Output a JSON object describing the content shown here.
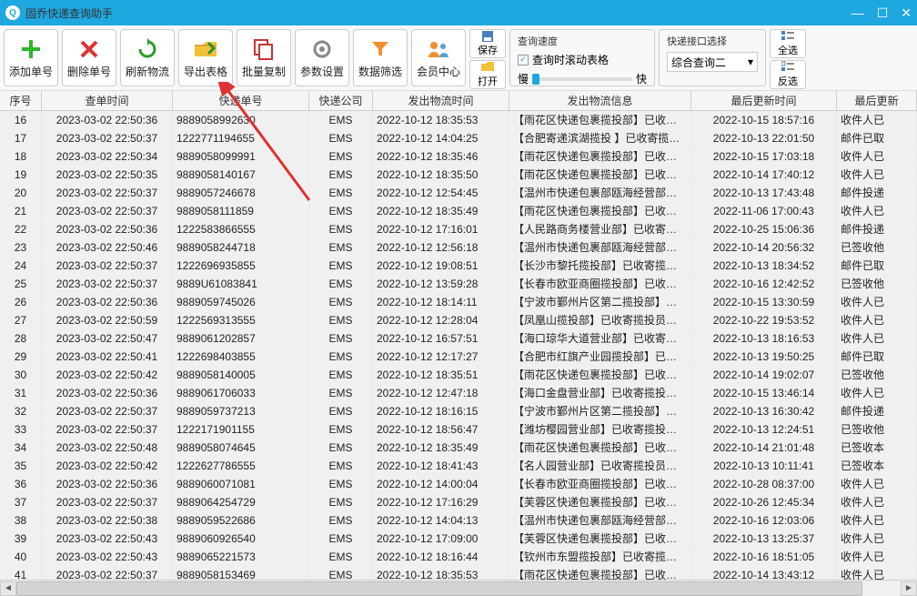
{
  "window": {
    "title": "固乔快递查询助手"
  },
  "toolbar": {
    "add": "添加单号",
    "del": "删除单号",
    "refresh": "刷新物流",
    "export": "导出表格",
    "copy": "批量复制",
    "params": "参数设置",
    "filter": "数据筛选",
    "member": "会员中心",
    "save": "保存",
    "open": "打开",
    "select_all": "全选",
    "invert": "反选"
  },
  "speed": {
    "group_label": "查询速度",
    "scroll_label": "查询时滚动表格",
    "slow": "慢",
    "fast": "快"
  },
  "interface": {
    "group_label": "快递接口选择",
    "selected": "综合查询二"
  },
  "columns": [
    "序号",
    "查单时间",
    "快递单号",
    "快递公司",
    "发出物流时间",
    "发出物流信息",
    "最后更新时间",
    "最后更新"
  ],
  "rows": [
    {
      "n": "16",
      "t": "2023-03-02 22:50:36",
      "no": "9889058992630",
      "co": "EMS",
      "ot": "2022-10-12 18:35:53",
      "oi": "【雨花区快递包裹揽投部】已收…",
      "lt": "2022-10-15 18:57:16",
      "ls": "收件人已"
    },
    {
      "n": "17",
      "t": "2023-03-02 22:50:37",
      "no": "1222771194655",
      "co": "EMS",
      "ot": "2022-10-12 14:04:25",
      "oi": "【合肥寄递滨湖揽投 】已收寄揽…",
      "lt": "2022-10-13 22:01:50",
      "ls": "邮件已取"
    },
    {
      "n": "18",
      "t": "2023-03-02 22:50:34",
      "no": "9889058099991",
      "co": "EMS",
      "ot": "2022-10-12 18:35:46",
      "oi": "【雨花区快递包裹揽投部】已收…",
      "lt": "2022-10-15 17:03:18",
      "ls": "收件人已"
    },
    {
      "n": "19",
      "t": "2023-03-02 22:50:35",
      "no": "9889058140167",
      "co": "EMS",
      "ot": "2022-10-12 18:35:50",
      "oi": "【雨花区快递包裹揽投部】已收…",
      "lt": "2022-10-14 17:40:12",
      "ls": "收件人已"
    },
    {
      "n": "20",
      "t": "2023-03-02 22:50:37",
      "no": "9889057246678",
      "co": "EMS",
      "ot": "2022-10-12 12:54:45",
      "oi": "【温州市快递包裹部瓯海经营部…",
      "lt": "2022-10-13 17:43:48",
      "ls": "邮件投递"
    },
    {
      "n": "21",
      "t": "2023-03-02 22:50:37",
      "no": "9889058111859",
      "co": "EMS",
      "ot": "2022-10-12 18:35:49",
      "oi": "【雨花区快递包裹揽投部】已收…",
      "lt": "2022-11-06 17:00:43",
      "ls": "收件人已"
    },
    {
      "n": "22",
      "t": "2023-03-02 22:50:36",
      "no": "1222583866555",
      "co": "EMS",
      "ot": "2022-10-12 17:16:01",
      "oi": "【人民路商务楼营业部】已收寄…",
      "lt": "2022-10-25 15:06:36",
      "ls": "邮件投递"
    },
    {
      "n": "23",
      "t": "2023-03-02 22:50:46",
      "no": "9889058244718",
      "co": "EMS",
      "ot": "2022-10-12 12:56:18",
      "oi": "【温州市快递包裹部瓯海经营部…",
      "lt": "2022-10-14 20:56:32",
      "ls": "已签收他"
    },
    {
      "n": "24",
      "t": "2023-03-02 22:50:37",
      "no": "1222696935855",
      "co": "EMS",
      "ot": "2022-10-12 19:08:51",
      "oi": "【长沙市黎托揽投部】已收寄揽…",
      "lt": "2022-10-13 18:34:52",
      "ls": "邮件已取"
    },
    {
      "n": "25",
      "t": "2023-03-02 22:50:37",
      "no": "9889U61083841",
      "co": "EMS",
      "ot": "2022-10-12 13:59:28",
      "oi": "【长春市欧亚商圈揽投部】已收…",
      "lt": "2022-10-16 12:42:52",
      "ls": "已签收他"
    },
    {
      "n": "26",
      "t": "2023-03-02 22:50:36",
      "no": "9889059745026",
      "co": "EMS",
      "ot": "2022-10-12 18:14:11",
      "oi": "【宁波市鄞州片区第二揽投部】…",
      "lt": "2022-10-15 13:30:59",
      "ls": "收件人已"
    },
    {
      "n": "27",
      "t": "2023-03-02 22:50:59",
      "no": "1222569313555",
      "co": "EMS",
      "ot": "2022-10-12 12:28:04",
      "oi": "【凤凰山揽投部】已收寄揽投员…",
      "lt": "2022-10-22 19:53:52",
      "ls": "收件人已"
    },
    {
      "n": "28",
      "t": "2023-03-02 22:50:47",
      "no": "9889061202857",
      "co": "EMS",
      "ot": "2022-10-12 16:57:51",
      "oi": "【海口琼华大道营业部】已收寄…",
      "lt": "2022-10-13 18:16:53",
      "ls": "收件人已"
    },
    {
      "n": "29",
      "t": "2023-03-02 22:50:41",
      "no": "1222698403855",
      "co": "EMS",
      "ot": "2022-10-12 12:17:27",
      "oi": "【合肥市红旗产业园揽投部】已…",
      "lt": "2022-10-13 19:50:25",
      "ls": "邮件已取"
    },
    {
      "n": "30",
      "t": "2023-03-02 22:50:42",
      "no": "9889058140005",
      "co": "EMS",
      "ot": "2022-10-12 18:35:51",
      "oi": "【雨花区快递包裹揽投部】已收…",
      "lt": "2022-10-14 19:02:07",
      "ls": "已签收他"
    },
    {
      "n": "31",
      "t": "2023-03-02 22:50:36",
      "no": "9889061706033",
      "co": "EMS",
      "ot": "2022-10-12 12:47:18",
      "oi": "【海口金盘营业部】已收寄揽投…",
      "lt": "2022-10-15 13:46:14",
      "ls": "收件人已"
    },
    {
      "n": "32",
      "t": "2023-03-02 22:50:37",
      "no": "9889059737213",
      "co": "EMS",
      "ot": "2022-10-12 18:16:15",
      "oi": "【宁波市鄞州片区第二揽投部】…",
      "lt": "2022-10-13 16:30:42",
      "ls": "邮件投递"
    },
    {
      "n": "33",
      "t": "2023-03-02 22:50:37",
      "no": "1222171901155",
      "co": "EMS",
      "ot": "2022-10-12 18:56:47",
      "oi": "【潍坊樱园营业部】已收寄揽投…",
      "lt": "2022-10-13 12:24:51",
      "ls": "已签收他"
    },
    {
      "n": "34",
      "t": "2023-03-02 22:50:48",
      "no": "9889058074645",
      "co": "EMS",
      "ot": "2022-10-12 18:35:49",
      "oi": "【雨花区快递包裹揽投部】已收…",
      "lt": "2022-10-14 21:01:48",
      "ls": "已签收本"
    },
    {
      "n": "35",
      "t": "2023-03-02 22:50:42",
      "no": "1222627786555",
      "co": "EMS",
      "ot": "2022-10-12 18:41:43",
      "oi": "【名人园营业部】已收寄揽投员…",
      "lt": "2022-10-13 10:11:41",
      "ls": "已签收本"
    },
    {
      "n": "36",
      "t": "2023-03-02 22:50:36",
      "no": "9889060071081",
      "co": "EMS",
      "ot": "2022-10-12 14:00:04",
      "oi": "【长春市欧亚商圈揽投部】已收…",
      "lt": "2022-10-28 08:37:00",
      "ls": "收件人已"
    },
    {
      "n": "37",
      "t": "2023-03-02 22:50:37",
      "no": "9889064254729",
      "co": "EMS",
      "ot": "2022-10-12 17:16:29",
      "oi": "【芙蓉区快递包裹揽投部】已收…",
      "lt": "2022-10-26 12:45:34",
      "ls": "收件人已"
    },
    {
      "n": "38",
      "t": "2023-03-02 22:50:38",
      "no": "9889059522686",
      "co": "EMS",
      "ot": "2022-10-12 14:04:13",
      "oi": "【温州市快递包裹部瓯海经营部…",
      "lt": "2022-10-16 12:03:06",
      "ls": "收件人已"
    },
    {
      "n": "39",
      "t": "2023-03-02 22:50:43",
      "no": "9889060926540",
      "co": "EMS",
      "ot": "2022-10-12 17:09:00",
      "oi": "【芙蓉区快递包裹揽投部】已收…",
      "lt": "2022-10-13 13:25:37",
      "ls": "收件人已"
    },
    {
      "n": "40",
      "t": "2023-03-02 22:50:43",
      "no": "9889065221573",
      "co": "EMS",
      "ot": "2022-10-12 18:16:44",
      "oi": "【钦州市东盟揽投部】已收寄揽…",
      "lt": "2022-10-16 18:51:05",
      "ls": "收件人已"
    },
    {
      "n": "41",
      "t": "2023-03-02 22:50:37",
      "no": "9889058153469",
      "co": "EMS",
      "ot": "2022-10-12 18:35:53",
      "oi": "【雨花区快递包裹揽投部】已收…",
      "lt": "2022-10-14 13:43:12",
      "ls": "收件人已"
    }
  ]
}
